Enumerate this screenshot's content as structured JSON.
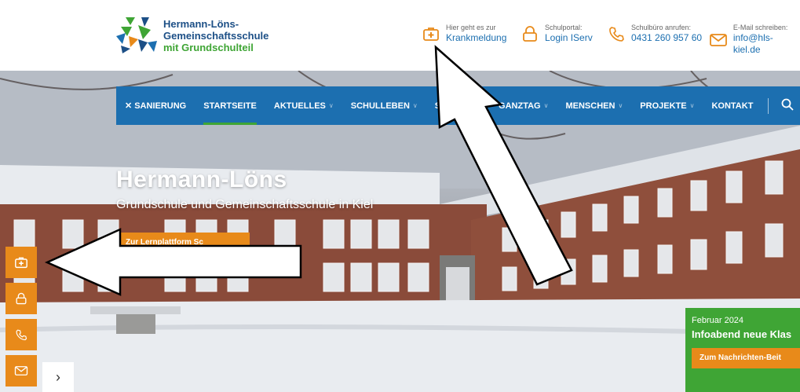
{
  "logo": {
    "line1": "Hermann-Löns-",
    "line2": "Gemeinschaftsschule",
    "line3": "mit Grundschulteil"
  },
  "contacts": [
    {
      "small": "Hier geht es zur",
      "big": "Krankmeldung",
      "icon": "first-aid-icon"
    },
    {
      "small": "Schulportal:",
      "big": "Login IServ",
      "icon": "lock-icon"
    },
    {
      "small": "Schulbüro anrufen:",
      "big": "0431 260 957 60",
      "icon": "phone-icon"
    },
    {
      "small": "E-Mail schreiben:",
      "big": "info@hls-kiel.de",
      "icon": "mail-icon"
    }
  ],
  "nav": {
    "items": [
      {
        "label": "Sanierung",
        "icon": "tools-icon"
      },
      {
        "label": "Startseite",
        "active": true
      },
      {
        "label": "Aktuelles",
        "dropdown": true
      },
      {
        "label": "Schulleben",
        "dropdown": true
      },
      {
        "label": "Schu",
        "dropdown": false
      },
      {
        "label": "Ganztag",
        "dropdown": true
      },
      {
        "label": "Menschen",
        "dropdown": true
      },
      {
        "label": "Projekte",
        "dropdown": true
      },
      {
        "label": "Kontakt"
      }
    ]
  },
  "hero": {
    "title": "Hermann-Löns",
    "subtitle": "Grundschule und Gemeinschaftsschule in Kiel",
    "button": "Zur Lernplattform Sc"
  },
  "sidebar": {
    "buttons": [
      "first-aid-icon",
      "lock-icon",
      "phone-icon",
      "mail-icon"
    ],
    "toggle": "›"
  },
  "news": {
    "date": "Februar 2024",
    "title": "Infoabend neue Klas",
    "button": "Zum Nachrichten-Beit"
  },
  "colors": {
    "brand_blue": "#1c6fb0",
    "brand_green": "#3fa535",
    "accent_orange": "#e88a1a"
  }
}
